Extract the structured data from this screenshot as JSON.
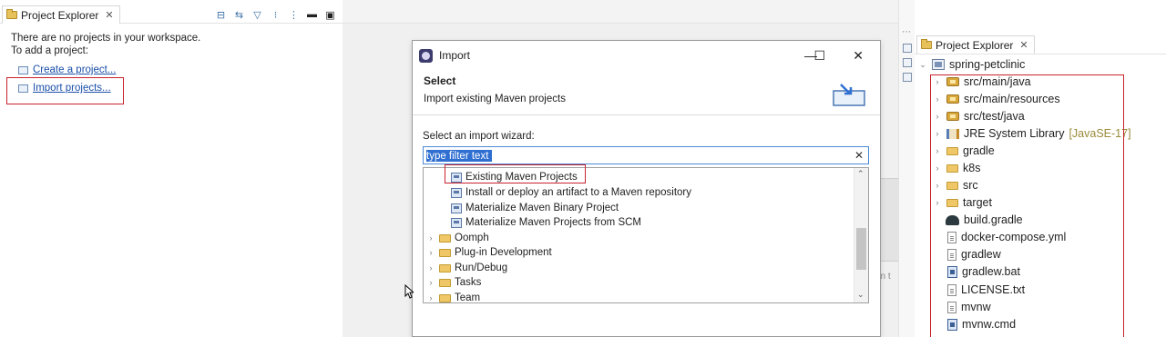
{
  "left_explorer": {
    "tab_title": "Project Explorer",
    "tab_close": "✕",
    "toolbar_icons": [
      "collapse-all-icon",
      "link-editor-icon",
      "filter-icon",
      "focus-icon",
      "view-menu-icon",
      "minimize-icon",
      "maximize-icon"
    ],
    "message_line1": "There are no projects in your workspace.",
    "message_line2": "To add a project:",
    "link_create": "Create a project...",
    "link_import": "Import projects..."
  },
  "editor": {
    "ghost_text": "en t"
  },
  "import_dialog": {
    "title": "Import",
    "minimize": "—",
    "maximize": "☐",
    "close": "✕",
    "header_title": "Select",
    "header_description": "Import existing Maven projects",
    "filter_label": "Select an import wizard:",
    "filter_value": "type filter text",
    "filter_clear": "✕",
    "tree_items": [
      {
        "label": "Existing Maven Projects",
        "kind": "wizard",
        "selected": true
      },
      {
        "label": "Install or deploy an artifact to a Maven repository",
        "kind": "wizard"
      },
      {
        "label": "Materialize Maven Binary Project",
        "kind": "wizard"
      },
      {
        "label": "Materialize Maven Projects from SCM",
        "kind": "wizard"
      },
      {
        "label": "Oomph",
        "kind": "folder"
      },
      {
        "label": "Plug-in Development",
        "kind": "folder"
      },
      {
        "label": "Run/Debug",
        "kind": "folder"
      },
      {
        "label": "Tasks",
        "kind": "folder"
      },
      {
        "label": "Team",
        "kind": "folder"
      }
    ]
  },
  "right_explorer": {
    "tab_title": "Project Explorer",
    "tab_close": "✕",
    "project": "spring-petclinic",
    "items": [
      {
        "label": "src/main/java",
        "icon": "source-folder-icon",
        "expandable": true
      },
      {
        "label": "src/main/resources",
        "icon": "source-folder-icon",
        "expandable": true
      },
      {
        "label": "src/test/java",
        "icon": "source-folder-icon",
        "expandable": true
      },
      {
        "label": "JRE System Library",
        "decoration": "[JavaSE-17]",
        "icon": "library-icon",
        "expandable": true
      },
      {
        "label": "gradle",
        "icon": "folder-icon",
        "expandable": true
      },
      {
        "label": "k8s",
        "icon": "folder-icon",
        "expandable": true
      },
      {
        "label": "src",
        "icon": "folder-icon",
        "expandable": true
      },
      {
        "label": "target",
        "icon": "folder-icon",
        "expandable": true
      },
      {
        "label": "build.gradle",
        "icon": "gradle-file-icon",
        "expandable": false
      },
      {
        "label": "docker-compose.yml",
        "icon": "file-icon",
        "expandable": false
      },
      {
        "label": "gradlew",
        "icon": "file-icon",
        "expandable": false
      },
      {
        "label": "gradlew.bat",
        "icon": "batch-file-icon",
        "expandable": false
      },
      {
        "label": "LICENSE.txt",
        "icon": "file-icon",
        "expandable": false
      },
      {
        "label": "mvnw",
        "icon": "file-icon",
        "expandable": false
      },
      {
        "label": "mvnw.cmd",
        "icon": "batch-file-icon",
        "expandable": false
      }
    ]
  },
  "colors": {
    "highlight_box": "#c8232c",
    "link": "#1a4fa8",
    "selection": "#2f6fd1"
  }
}
